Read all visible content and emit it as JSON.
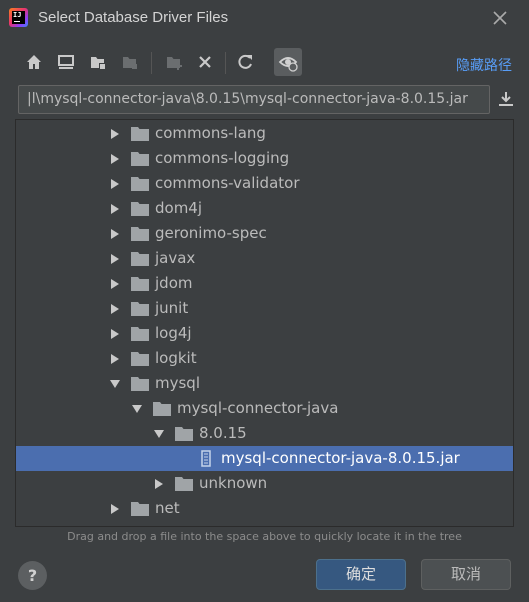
{
  "window": {
    "title": "Select Database Driver Files",
    "app_icon_text": "IJ"
  },
  "toolbar": {
    "buttons": [
      {
        "icon": "home-icon"
      },
      {
        "icon": "desktop-icon"
      },
      {
        "icon": "project-folder-icon"
      },
      {
        "icon": "module-folder-icon"
      },
      {
        "icon": "new-folder-icon"
      },
      {
        "icon": "delete-icon"
      },
      {
        "icon": "refresh-icon"
      },
      {
        "icon": "show-hidden-icon"
      }
    ],
    "hide_path_label": "隐藏路径"
  },
  "path": {
    "value": "|l\\mysql-connector-java\\8.0.15\\mysql-connector-java-8.0.15.jar"
  },
  "tree": {
    "items": [
      {
        "label": "commons-lang",
        "type": "folder",
        "expanded": false
      },
      {
        "label": "commons-logging",
        "type": "folder",
        "expanded": false
      },
      {
        "label": "commons-validator",
        "type": "folder",
        "expanded": false
      },
      {
        "label": "dom4j",
        "type": "folder",
        "expanded": false
      },
      {
        "label": "geronimo-spec",
        "type": "folder",
        "expanded": false
      },
      {
        "label": "javax",
        "type": "folder",
        "expanded": false
      },
      {
        "label": "jdom",
        "type": "folder",
        "expanded": false
      },
      {
        "label": "junit",
        "type": "folder",
        "expanded": false
      },
      {
        "label": "log4j",
        "type": "folder",
        "expanded": false
      },
      {
        "label": "logkit",
        "type": "folder",
        "expanded": false
      },
      {
        "label": "mysql",
        "type": "folder",
        "expanded": true
      },
      {
        "label": "mysql-connector-java",
        "type": "folder",
        "expanded": true
      },
      {
        "label": "8.0.15",
        "type": "folder",
        "expanded": true
      },
      {
        "label": "mysql-connector-java-8.0.15.jar",
        "type": "jar",
        "selected": true
      },
      {
        "label": "unknown",
        "type": "folder",
        "expanded": false
      },
      {
        "label": "net",
        "type": "folder",
        "expanded": false
      }
    ]
  },
  "hint": "Drag and drop a file into the space above to quickly locate it in the tree",
  "buttons": {
    "help": "?",
    "ok": "确定",
    "cancel": "取消"
  },
  "colors": {
    "background": "#3c3f41",
    "selection": "#4b6eaf",
    "link": "#589df6",
    "primary_button": "#365880"
  }
}
